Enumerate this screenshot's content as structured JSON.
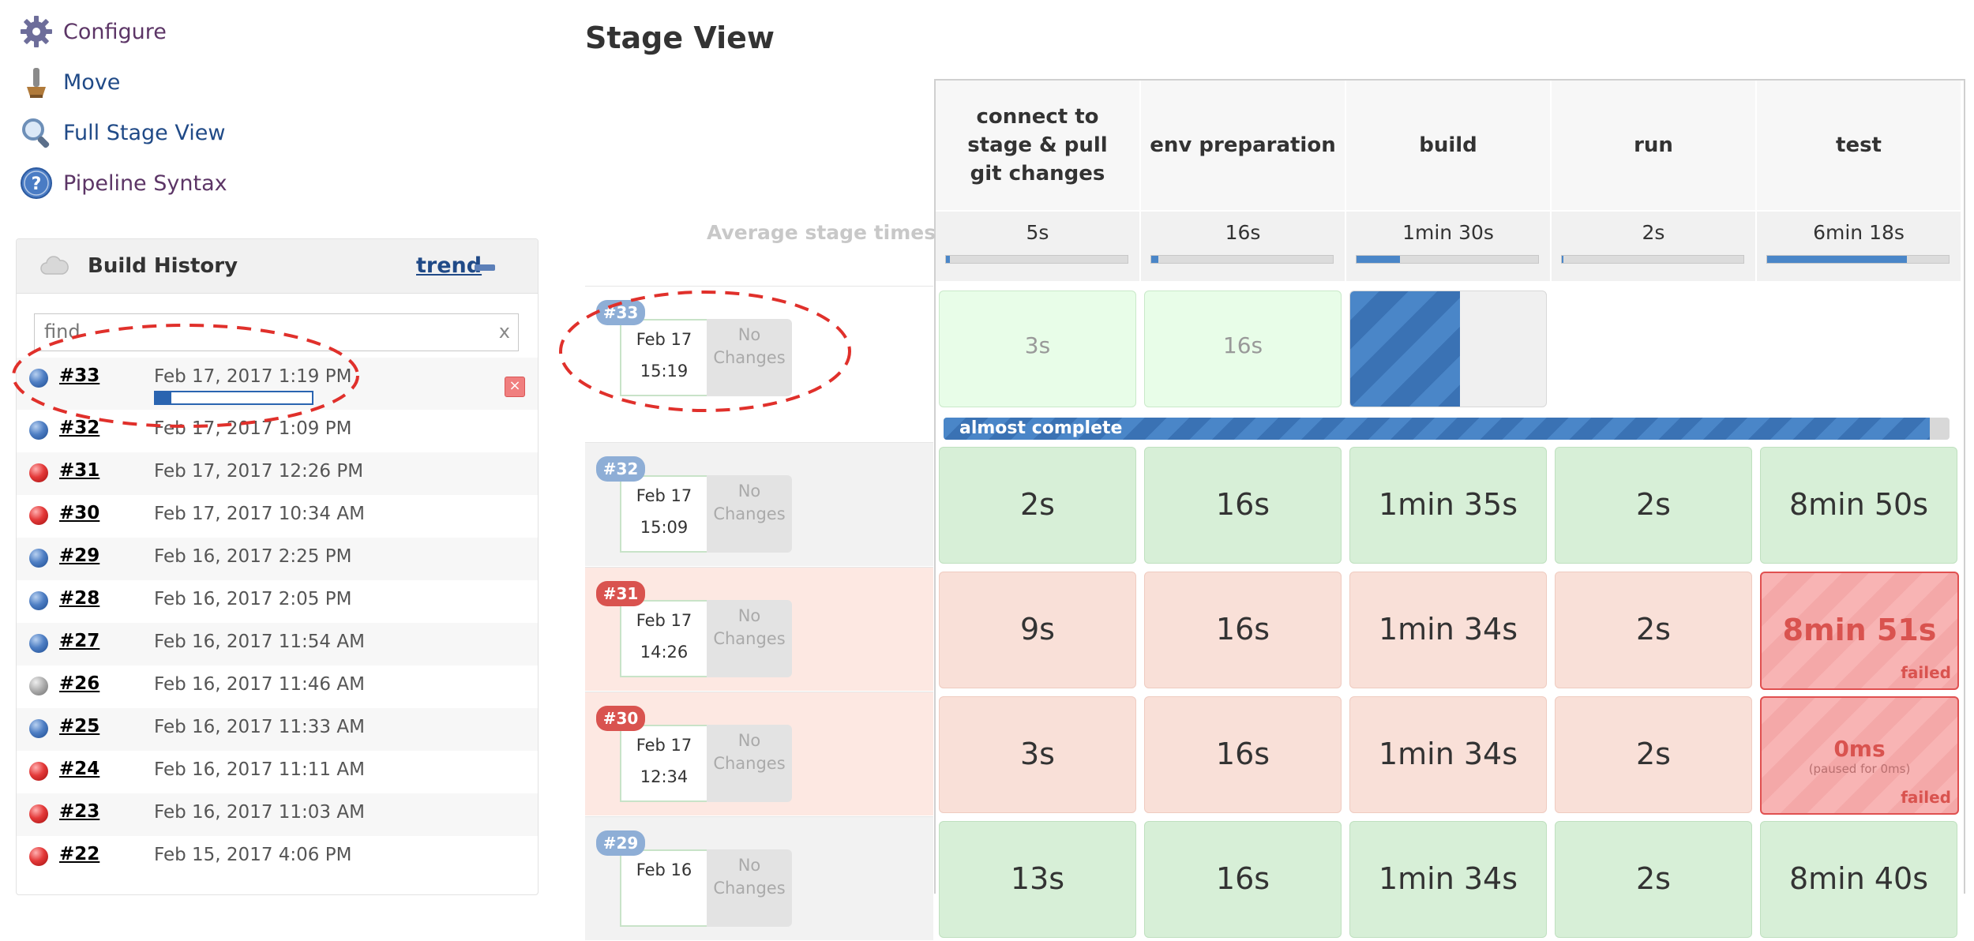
{
  "tasks": [
    {
      "label": "Configure",
      "icon": "gear-icon"
    },
    {
      "label": "Move",
      "icon": "move-icon"
    },
    {
      "label": "Full Stage View",
      "icon": "magnifier-icon"
    },
    {
      "label": "Pipeline Syntax",
      "icon": "help-icon"
    }
  ],
  "build_history": {
    "title": "Build History",
    "trend_label": "trend",
    "search": {
      "placeholder": "find",
      "value": "",
      "clear_label": "x"
    },
    "builds": [
      {
        "number": "#33",
        "date": "Feb 17, 2017 1:19 PM",
        "status": "blue",
        "progress": 0.1
      },
      {
        "number": "#32",
        "date": "Feb 17, 2017 1:09 PM",
        "status": "blue"
      },
      {
        "number": "#31",
        "date": "Feb 17, 2017 12:26 PM",
        "status": "red"
      },
      {
        "number": "#30",
        "date": "Feb 17, 2017 10:34 AM",
        "status": "red"
      },
      {
        "number": "#29",
        "date": "Feb 16, 2017 2:25 PM",
        "status": "blue"
      },
      {
        "number": "#28",
        "date": "Feb 16, 2017 2:05 PM",
        "status": "blue"
      },
      {
        "number": "#27",
        "date": "Feb 16, 2017 11:54 AM",
        "status": "blue"
      },
      {
        "number": "#26",
        "date": "Feb 16, 2017 11:46 AM",
        "status": "grey"
      },
      {
        "number": "#25",
        "date": "Feb 16, 2017 11:33 AM",
        "status": "blue"
      },
      {
        "number": "#24",
        "date": "Feb 16, 2017 11:11 AM",
        "status": "red"
      },
      {
        "number": "#23",
        "date": "Feb 16, 2017 11:03 AM",
        "status": "red"
      },
      {
        "number": "#22",
        "date": "Feb 15, 2017 4:06 PM",
        "status": "red"
      }
    ]
  },
  "stage_view": {
    "title": "Stage View",
    "average_label": "Average stage times:",
    "stages": [
      {
        "name": "connect to stage & pull git changes",
        "avg": "5s",
        "avg_fraction": 0.02
      },
      {
        "name": "env preparation",
        "avg": "16s",
        "avg_fraction": 0.04
      },
      {
        "name": "build",
        "avg": "1min 30s",
        "avg_fraction": 0.24
      },
      {
        "name": "run",
        "avg": "2s",
        "avg_fraction": 0.01
      },
      {
        "name": "test",
        "avg": "6min 18s",
        "avg_fraction": 0.77
      }
    ],
    "progress": {
      "label": "almost complete",
      "fraction": 0.98
    },
    "runs": [
      {
        "badge": "#33",
        "badge_color": "blue",
        "date": "Feb 17",
        "time": "15:19",
        "changes": "No Changes",
        "cells": [
          {
            "value": "3s",
            "state": "lgreen"
          },
          {
            "value": "16s",
            "state": "lgreen"
          },
          {
            "value": "",
            "state": "running",
            "progress": 0.56
          },
          {
            "value": "",
            "state": "empty"
          },
          {
            "value": "",
            "state": "empty"
          }
        ]
      },
      {
        "badge": "#32",
        "badge_color": "blue",
        "date": "Feb 17",
        "time": "15:09",
        "changes": "No Changes",
        "cells": [
          {
            "value": "2s",
            "state": "green"
          },
          {
            "value": "16s",
            "state": "green"
          },
          {
            "value": "1min 35s",
            "state": "green"
          },
          {
            "value": "2s",
            "state": "green"
          },
          {
            "value": "8min 50s",
            "state": "green"
          }
        ]
      },
      {
        "badge": "#31",
        "badge_color": "red",
        "date": "Feb 17",
        "time": "14:26",
        "changes": "No Changes",
        "cells": [
          {
            "value": "9s",
            "state": "pink"
          },
          {
            "value": "16s",
            "state": "pink"
          },
          {
            "value": "1min 34s",
            "state": "pink"
          },
          {
            "value": "2s",
            "state": "pink"
          },
          {
            "value": "8min 51s",
            "state": "failed",
            "flag": "failed"
          }
        ]
      },
      {
        "badge": "#30",
        "badge_color": "red",
        "date": "Feb 17",
        "time": "12:34",
        "changes": "No Changes",
        "cells": [
          {
            "value": "3s",
            "state": "pink"
          },
          {
            "value": "16s",
            "state": "pink"
          },
          {
            "value": "1min 34s",
            "state": "pink"
          },
          {
            "value": "2s",
            "state": "pink"
          },
          {
            "value": "0ms",
            "state": "failed",
            "note": "(paused for 0ms)",
            "flag": "failed"
          }
        ]
      },
      {
        "badge": "#29",
        "badge_color": "blue",
        "date": "Feb 16",
        "time": "",
        "changes": "No Changes",
        "cells": [
          {
            "value": "13s",
            "state": "green"
          },
          {
            "value": "16s",
            "state": "green"
          },
          {
            "value": "1min 34s",
            "state": "green"
          },
          {
            "value": "2s",
            "state": "green"
          },
          {
            "value": "8min 40s",
            "state": "green"
          }
        ]
      }
    ]
  },
  "annotation_color": "#e0302b"
}
